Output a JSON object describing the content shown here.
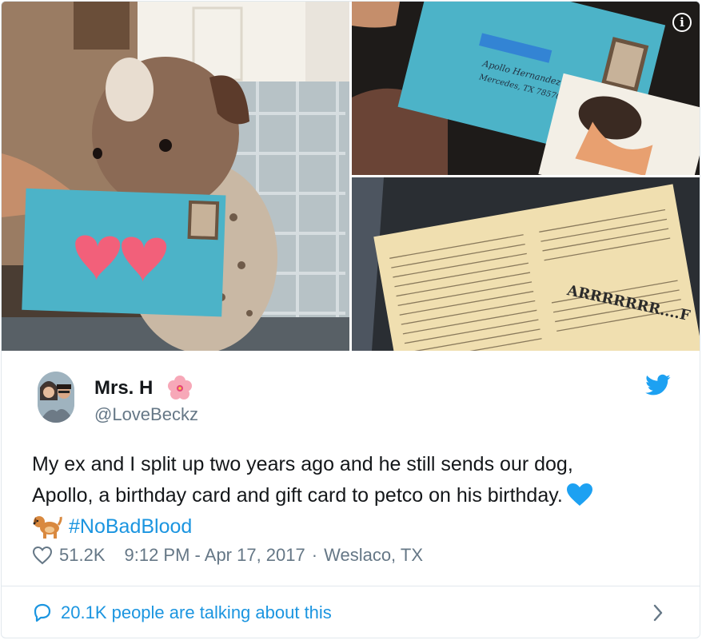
{
  "tweet": {
    "display_name": "Mrs. H",
    "handle": "@LoveBeckz",
    "text_line1": "My ex and I split up two years ago and he still sends our dog,",
    "text_line2": "Apollo, a birthday card and gift card to petco on his birthday.",
    "hashtag": "#NoBadBlood",
    "like_count": "51.2K",
    "timestamp": "9:12 PM - Apr 17, 2017",
    "separator": "·",
    "location": "Weslaco, TX",
    "conversation_label": "20.1K people are talking about this"
  },
  "media": {
    "info_glyph": "i",
    "envelope_address": "Apollo Hernandez\nMercedes, TX 78570",
    "letter_exclaim": "ARRRRRRR....F"
  },
  "colors": {
    "link": "#1b95e0",
    "secondary": "#657786",
    "envelope": "#4cb3c8",
    "heart_pink": "#f2607a"
  },
  "icons": [
    "info-icon",
    "twitter-bird-icon",
    "flower-emoji-icon",
    "blue-heart-emoji-icon",
    "dog-emoji-icon",
    "like-heart-icon",
    "reply-bubble-icon",
    "chevron-right-icon"
  ]
}
